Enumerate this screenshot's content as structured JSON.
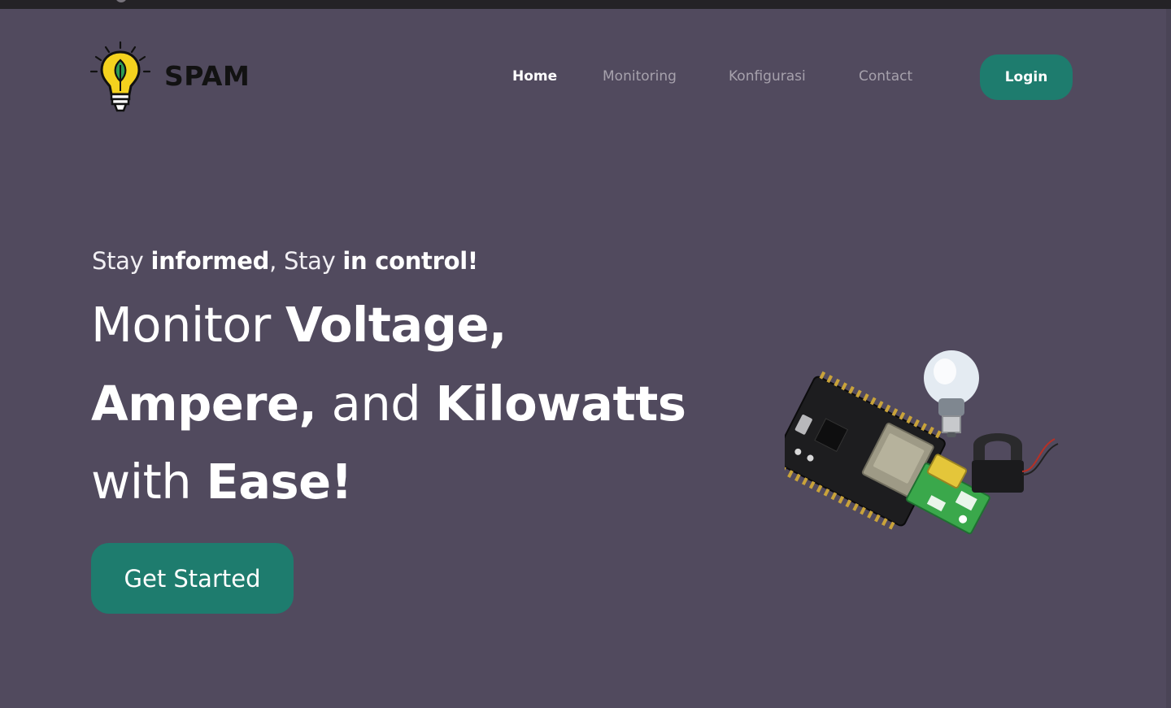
{
  "header": {
    "brand": "SPAM",
    "nav": [
      {
        "label": "Home",
        "active": true
      },
      {
        "label": "Monitoring",
        "active": false
      },
      {
        "label": "Konfigurasi",
        "active": false
      },
      {
        "label": "Contact",
        "active": false
      }
    ],
    "login_label": "Login"
  },
  "hero": {
    "tagline": {
      "p1": "Stay ",
      "b1": "informed",
      "p2": ", Stay ",
      "b2": "in control!"
    },
    "headline": {
      "l1_plain": "Monitor ",
      "l1_bold": "Voltage,",
      "l2_bold1": "Ampere,",
      "l2_plain": " and ",
      "l2_bold2": "Kilowatts",
      "l3_plain": "with ",
      "l3_bold": "Ease!"
    },
    "cta_label": "Get Started"
  },
  "icons": {
    "logo": "lightbulb-leaf-icon",
    "hero_image": "esp-board-bulb-sensor-illustration"
  },
  "colors": {
    "background": "#514a5e",
    "accent": "#1e7c6e",
    "topbar": "#242226",
    "nav_inactive": "#a6a1ac"
  }
}
